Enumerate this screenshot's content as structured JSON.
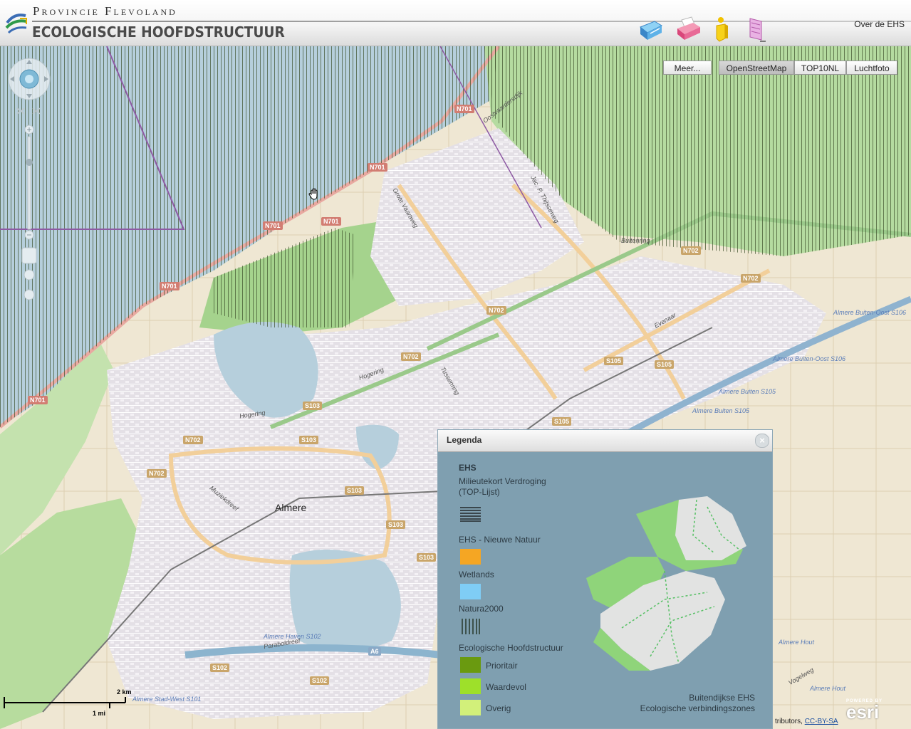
{
  "header": {
    "org_name": "Provincie Flevoland",
    "app_title": "ECOLOGISCHE HOOFDSTRUCTUUR",
    "about_link": "Over de EHS",
    "tools": [
      "info-book-icon",
      "print-icon",
      "identify-icon",
      "layers-icon"
    ]
  },
  "basemap": {
    "more_button": "Meer...",
    "options": [
      "OpenStreetMap",
      "TOP10NL",
      "Luchtfoto"
    ],
    "active": "OpenStreetMap"
  },
  "legend": {
    "title": "Legenda",
    "close": "×",
    "group_ehs": "EHS",
    "milieu_label_1": "Milieutekort Verdroging",
    "milieu_label_2": "(TOP-Lijst)",
    "nieuwe_natuur": "EHS - Nieuwe Natuur",
    "wetlands": "Wetlands",
    "natura2000": "Natura2000",
    "ecologische": "Ecologische Hoofdstructuur",
    "prioritair": "Prioritair",
    "waardevol": "Waardevol",
    "overig": "Overig",
    "buitendijkse": "Buitendijkse EHS",
    "verbindingszones": "Ecologische verbindingszones",
    "colors": {
      "nieuwe_natuur": "#f5a623",
      "wetlands": "#7fcdf5",
      "prioritair": "#6a9a10",
      "waardevol": "#9ee02a",
      "overig": "#d2f07a"
    }
  },
  "map": {
    "city_label": "Almere",
    "road_shields": [
      "N701",
      "N701",
      "N701",
      "N701",
      "N701",
      "N701",
      "N702",
      "N702",
      "N702",
      "N702",
      "N702",
      "N702",
      "S103",
      "S103",
      "S103",
      "S103",
      "S103",
      "S105",
      "S105",
      "S105",
      "S102",
      "S102",
      "A6"
    ],
    "street_labels": [
      "Oostvaardersdijk",
      "Grote Vaartweg",
      "Jac. P. Thijsseweg",
      "Buitenring",
      "Hogering",
      "Evenaar",
      "Tussenring",
      "Muziekdreef",
      "Hogering",
      "Paraboldreef",
      "Vogelweg"
    ],
    "station_labels": [
      "Almere Buiten-Oost S106",
      "Almere Buiten-Oost S106",
      "Almere Buiten S105",
      "Almere Buiten S105",
      "Almere Haven S102",
      "Almere Stad-West S101",
      "Almere Hout",
      "Almere Hout"
    ]
  },
  "scalebar": {
    "km": "2 km",
    "mi": "1 mi"
  },
  "attribution": {
    "text": "tributors,",
    "license": "CC-BY-SA"
  },
  "esri": {
    "powered": "POWERED BY",
    "brand": "esri"
  }
}
